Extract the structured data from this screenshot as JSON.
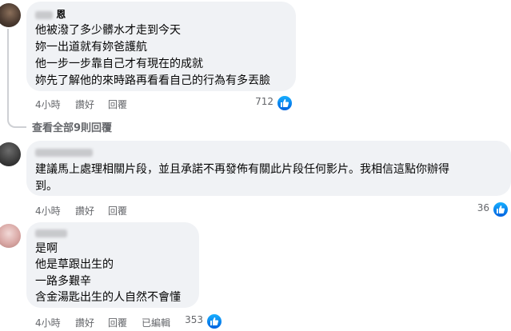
{
  "comments": [
    {
      "author": "恩",
      "lines": [
        "他被潑了多少髒水才走到今天",
        "妳一出道就有妳爸護航",
        "他一步一步靠自己才有現在的成就",
        "妳先了解他的來時路再看看自己的行為有多丟臉"
      ],
      "time": "4小時",
      "like_label": "讚好",
      "reply_label": "回覆",
      "reaction_count": "712"
    },
    {
      "author": "",
      "lines": [
        "建議馬上處理相關片段，並且承諾不再發佈有關此片段任何影片。我相信這點你辦得",
        "到。"
      ],
      "time": "4小時",
      "like_label": "讚好",
      "reply_label": "回覆",
      "reaction_count": "36"
    },
    {
      "author": "",
      "lines": [
        "是啊",
        "他是草跟出生的",
        "一路多艱辛",
        "含金湯匙出生的人自然不會懂"
      ],
      "time": "4小時",
      "like_label": "讚好",
      "reply_label": "回覆",
      "edited_label": "已編輯",
      "reaction_count": "353"
    }
  ],
  "view_all_replies": "查看全部9則回覆",
  "icons": {
    "reaction": "like-icon"
  },
  "colors": {
    "bubble": "#f0f2f5",
    "meta": "#65676b",
    "like": "#0866ff"
  }
}
